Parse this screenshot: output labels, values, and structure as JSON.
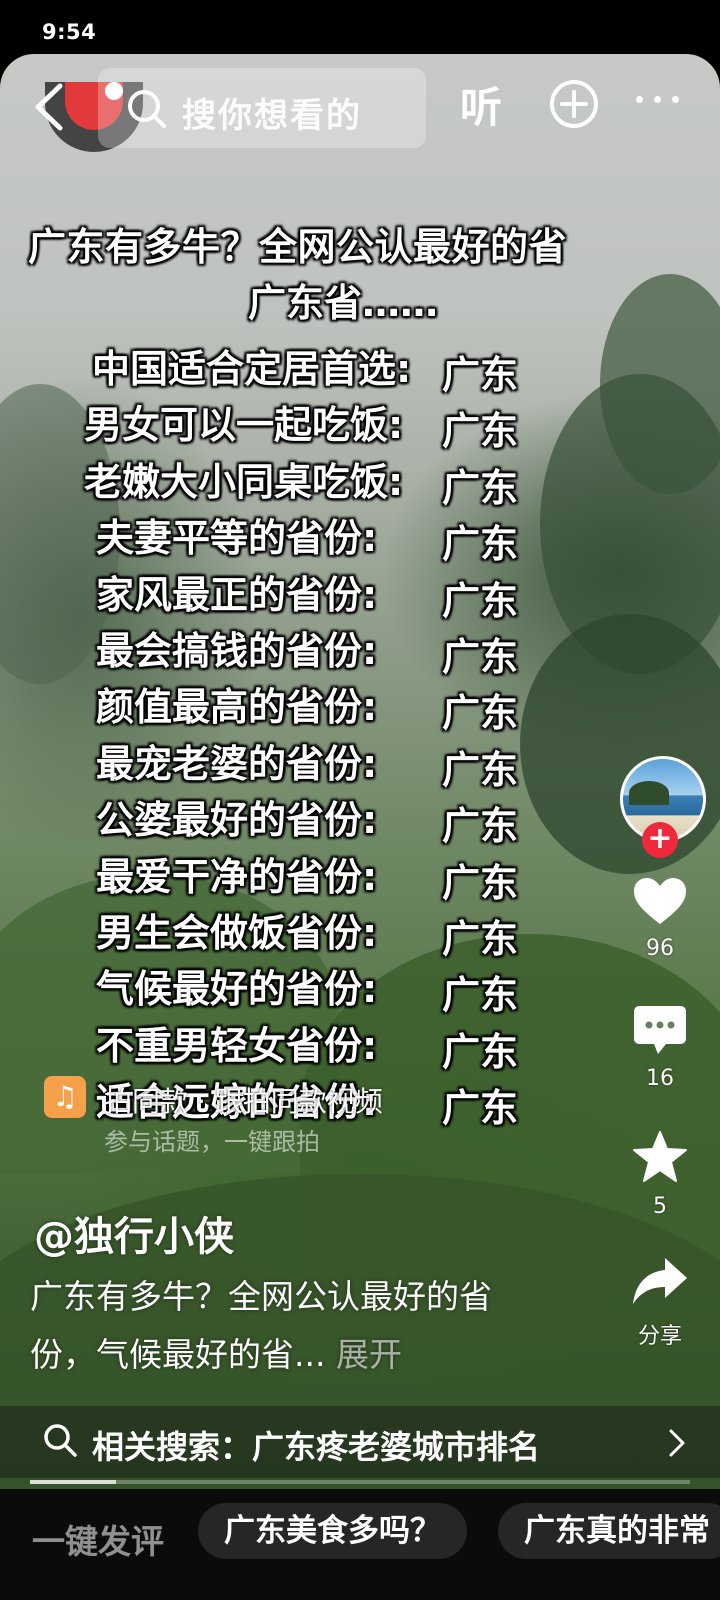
{
  "status_bar": {
    "time": "9:54"
  },
  "search": {
    "placeholder": "搜你想看的"
  },
  "header": {
    "listen_label": "听"
  },
  "overlay": {
    "title_line1": "广东有多牛？全网公认最好的省",
    "title_line2": "广东省……",
    "rows": [
      {
        "label": "中国适合定居首选:",
        "value": "广东"
      },
      {
        "label": "男女可以一起吃饭:",
        "value": "广东"
      },
      {
        "label": "老嫩大小同桌吃饭:",
        "value": "广东"
      },
      {
        "label": "夫妻平等的省份:",
        "value": "广东"
      },
      {
        "label": "家风最正的省份:",
        "value": "广东"
      },
      {
        "label": "最会搞钱的省份:",
        "value": "广东"
      },
      {
        "label": "颜值最高的省份:",
        "value": "广东"
      },
      {
        "label": "最宠老婆的省份:",
        "value": "广东"
      },
      {
        "label": "公婆最好的省份:",
        "value": "广东"
      },
      {
        "label": "最爱干净的省份:",
        "value": "广东"
      },
      {
        "label": "男生会做饭省份:",
        "value": "广东"
      },
      {
        "label": "气候最好的省份:",
        "value": "广东"
      },
      {
        "label": "不重男轻女省份:",
        "value": "广东"
      },
      {
        "label": "适合远嫁的省份:",
        "value": "广东"
      }
    ]
  },
  "actions": {
    "likes": "96",
    "comments": "16",
    "favorites": "5",
    "share_label": "分享"
  },
  "music": {
    "text": "拍同款 · 跟拍同款视频",
    "subtext": "参与话题，一键跟拍"
  },
  "post": {
    "author": "@独行小侠",
    "description": "广东有多牛？全网公认最好的省份，气候最好的省...",
    "expand_label": "展开"
  },
  "related_search": {
    "text": "相关搜索：广东疼老婆城市排名"
  },
  "progress": {
    "fraction": 0.13
  },
  "bottom": {
    "label": "一键发评",
    "chips": [
      "广东美食多吗？",
      "广东真的非常"
    ]
  },
  "colors": {
    "follow_red": "#f0283c",
    "music_orange": "#f5a04a",
    "record_red": "#e23a3a"
  }
}
